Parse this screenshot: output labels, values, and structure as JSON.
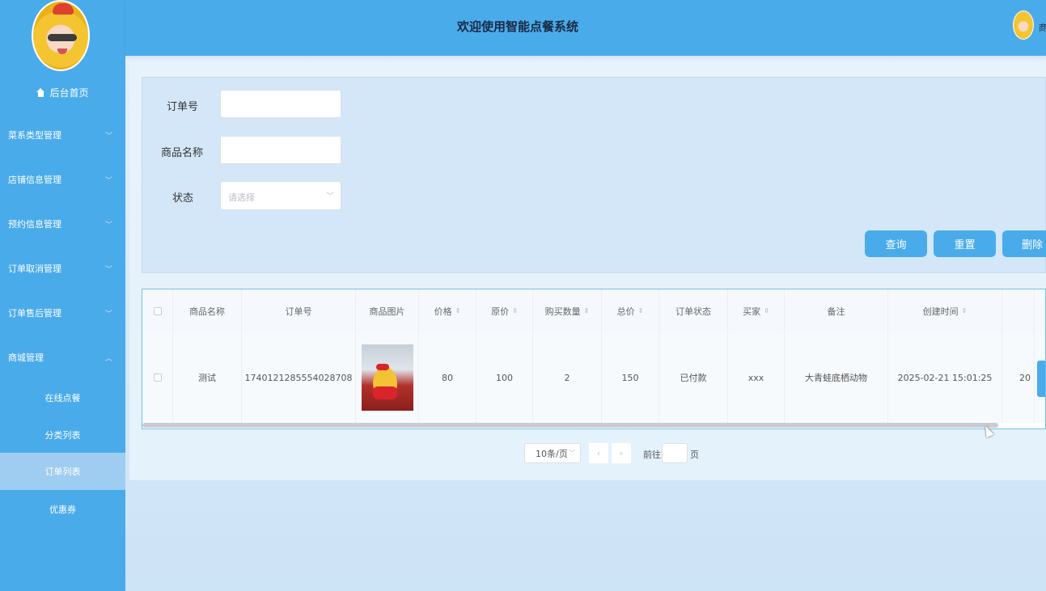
{
  "header": {
    "title": "欢迎使用智能点餐系统",
    "user_name": "商"
  },
  "sidebar": {
    "home_label": "后台首页",
    "menus": [
      {
        "label": "菜系类型管理",
        "expanded": false
      },
      {
        "label": "店铺信息管理",
        "expanded": false
      },
      {
        "label": "预约信息管理",
        "expanded": false
      },
      {
        "label": "订单取消管理",
        "expanded": false
      },
      {
        "label": "订单售后管理",
        "expanded": false
      },
      {
        "label": "商城管理",
        "expanded": true
      }
    ],
    "sub_items": [
      {
        "label": "在线点餐",
        "active": false
      },
      {
        "label": "分类列表",
        "active": false
      },
      {
        "label": "订单列表",
        "active": true
      },
      {
        "label": "优惠券",
        "active": false
      }
    ]
  },
  "search": {
    "order_no_label": "订单号",
    "order_no_value": "",
    "goods_name_label": "商品名称",
    "goods_name_value": "",
    "status_label": "状态",
    "status_placeholder": "请选择"
  },
  "actions": {
    "query": "查询",
    "reset": "重置",
    "delete": "删除"
  },
  "table": {
    "columns": [
      "商品名称",
      "订单号",
      "商品图片",
      "价格",
      "原价",
      "购买数量",
      "总价",
      "订单状态",
      "买家",
      "备注",
      "创建时间"
    ],
    "rows": [
      {
        "goods_name": "测试",
        "order_no": "1740121285554028708",
        "price": "80",
        "original_price": "100",
        "quantity": "2",
        "total": "150",
        "status": "已付款",
        "buyer": "xxx",
        "remark": "大青蛙底栖动物",
        "created_at": "2025-02-21 15:01:25",
        "extra": "20"
      }
    ]
  },
  "pagination": {
    "page_size": "10条/页",
    "prev": "‹",
    "next": "›",
    "goto_label": "前往",
    "goto_value": "",
    "goto_suffix": "页"
  },
  "colors": {
    "primary": "#4aabeb",
    "active_submenu": "#9fcdf1",
    "header_text": "#1a2a44"
  }
}
